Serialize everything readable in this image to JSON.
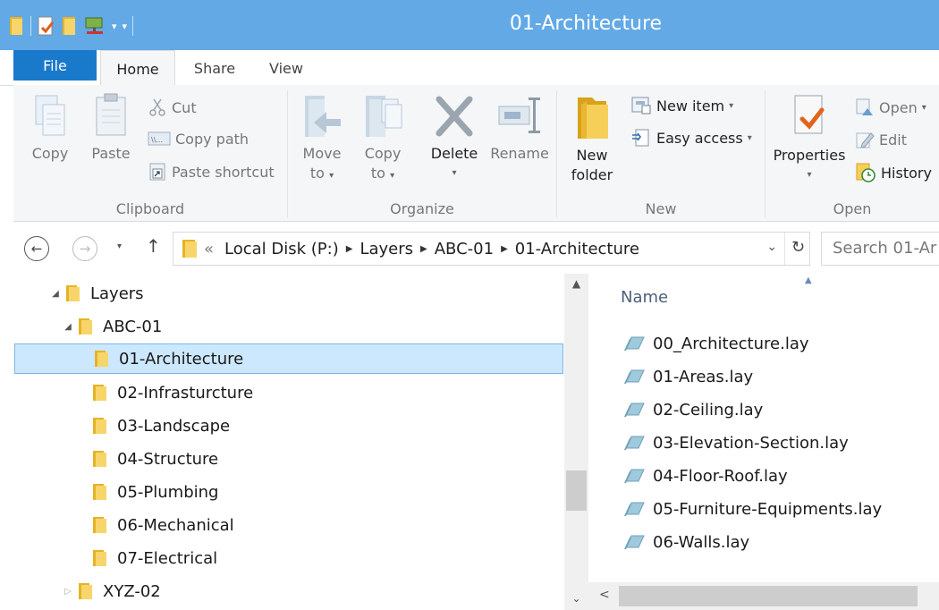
{
  "window": {
    "title": "01-Architecture"
  },
  "tabs": {
    "file": "File",
    "home": "Home",
    "share": "Share",
    "view": "View"
  },
  "ribbon": {
    "clipboard": {
      "label": "Clipboard",
      "copy": "Copy",
      "paste": "Paste",
      "cut": "Cut",
      "copy_path": "Copy path",
      "paste_shortcut": "Paste shortcut"
    },
    "organize": {
      "label": "Organize",
      "move_to": "Move",
      "move_to_2": "to",
      "copy_to": "Copy",
      "copy_to_2": "to",
      "delete": "Delete",
      "rename": "Rename"
    },
    "new": {
      "label": "New",
      "new_folder": "New",
      "new_folder_2": "folder",
      "new_item": "New item",
      "easy_access": "Easy access"
    },
    "open": {
      "label": "Open",
      "properties": "Properties",
      "open": "Open",
      "edit": "Edit",
      "history": "History"
    }
  },
  "address": {
    "overflow": "«",
    "crumbs": [
      "Local Disk (P:)",
      "Layers",
      "ABC-01",
      "01-Architecture"
    ],
    "search_placeholder": "Search 01-Ar"
  },
  "nav_tree": [
    {
      "label": "Layers",
      "expander": "◢"
    },
    {
      "label": "ABC-01",
      "expander": "◢"
    },
    {
      "label": "01-Architecture",
      "expander": ""
    },
    {
      "label": "02-Infrasturcture",
      "expander": ""
    },
    {
      "label": "03-Landscape",
      "expander": ""
    },
    {
      "label": "04-Structure",
      "expander": ""
    },
    {
      "label": "05-Plumbing",
      "expander": ""
    },
    {
      "label": "06-Mechanical",
      "expander": ""
    },
    {
      "label": "07-Electrical",
      "expander": ""
    },
    {
      "label": "XYZ-02",
      "expander": "▷"
    }
  ],
  "file_list": {
    "column_name": "Name",
    "files": [
      "00_Architecture.lay",
      "01-Areas.lay",
      "02-Ceiling.lay",
      "03-Elevation-Section.lay",
      "04-Floor-Roof.lay",
      "05-Furniture-Equipments.lay",
      "06-Walls.lay"
    ]
  }
}
